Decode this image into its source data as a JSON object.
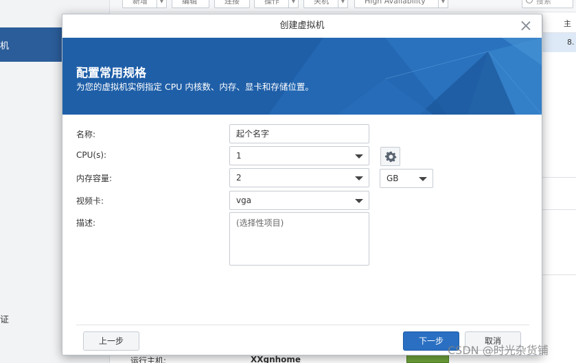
{
  "background": {
    "sidebar_active_label": "机",
    "sidebar_other_label": "证",
    "toolbar": {
      "buttons": [
        "新增",
        "编辑",
        "连接",
        "操作",
        "关机",
        "High Availability"
      ],
      "search_placeholder": "搜索"
    },
    "table": {
      "header": "主机",
      "row_value": "8."
    },
    "bottom": {
      "label": "运行主机:",
      "value": "XXgnhome"
    }
  },
  "dialog": {
    "title": "创建虚拟机",
    "banner": {
      "title": "配置常用规格",
      "subtitle": "为您的虚拟机实例指定 CPU 内核数、内存、显卡和存储位置。"
    },
    "fields": {
      "name": {
        "label": "名称:",
        "value": "起个名字"
      },
      "cpu": {
        "label": "CPU(s):",
        "value": "1"
      },
      "memory": {
        "label": "内存容量:",
        "value": "2",
        "unit": "GB"
      },
      "video": {
        "label": "视频卡:",
        "value": "vga"
      },
      "description": {
        "label": "描述:",
        "placeholder": "(选择性项目)"
      }
    },
    "buttons": {
      "prev": "上一步",
      "next": "下一步",
      "cancel": "取消"
    }
  },
  "watermark": "CSDN @时光杂货铺",
  "colors": {
    "banner": "#1f5fa8",
    "primary_button": "#2a6fc2",
    "sidebar_active": "#2b5d9a"
  }
}
